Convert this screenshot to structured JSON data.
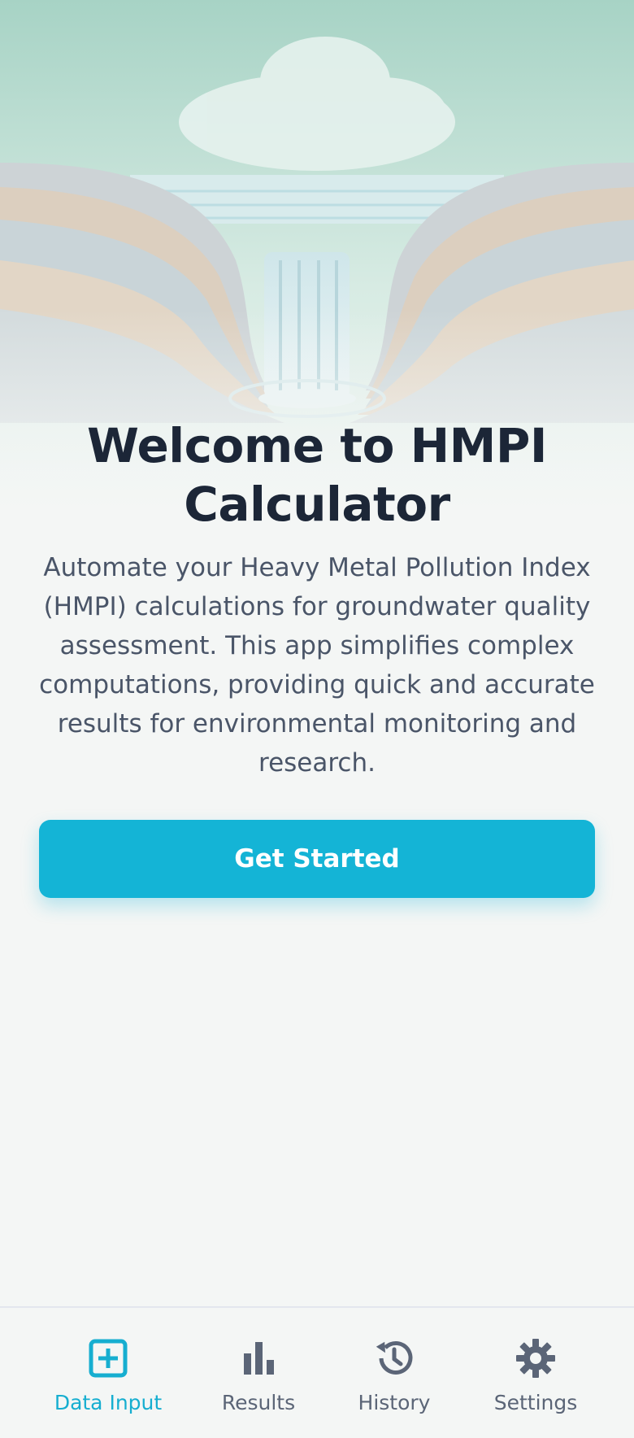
{
  "app": {
    "title": "Welcome to HMPI Calculator",
    "description": "Automate your Heavy Metal Pollution Index (HMPI) calculations for groundwater quality assessment. This app simplifies complex computations, providing quick and accurate results for environmental monitoring and research."
  },
  "hero": {
    "image": "waterfall-canyon-illustration"
  },
  "cta": {
    "label": "Get Started"
  },
  "nav": {
    "items": [
      {
        "label": "Data Input",
        "icon": "plus-square-icon",
        "active": true
      },
      {
        "label": "Results",
        "icon": "bar-chart-icon",
        "active": false
      },
      {
        "label": "History",
        "icon": "history-icon",
        "active": false
      },
      {
        "label": "Settings",
        "icon": "gear-icon",
        "active": false
      }
    ]
  },
  "colors": {
    "accent": "#14b4d6",
    "title": "#1c2637",
    "text": "#4a5568",
    "nav_inactive": "#5b6577",
    "background": "#f4f6f5"
  }
}
